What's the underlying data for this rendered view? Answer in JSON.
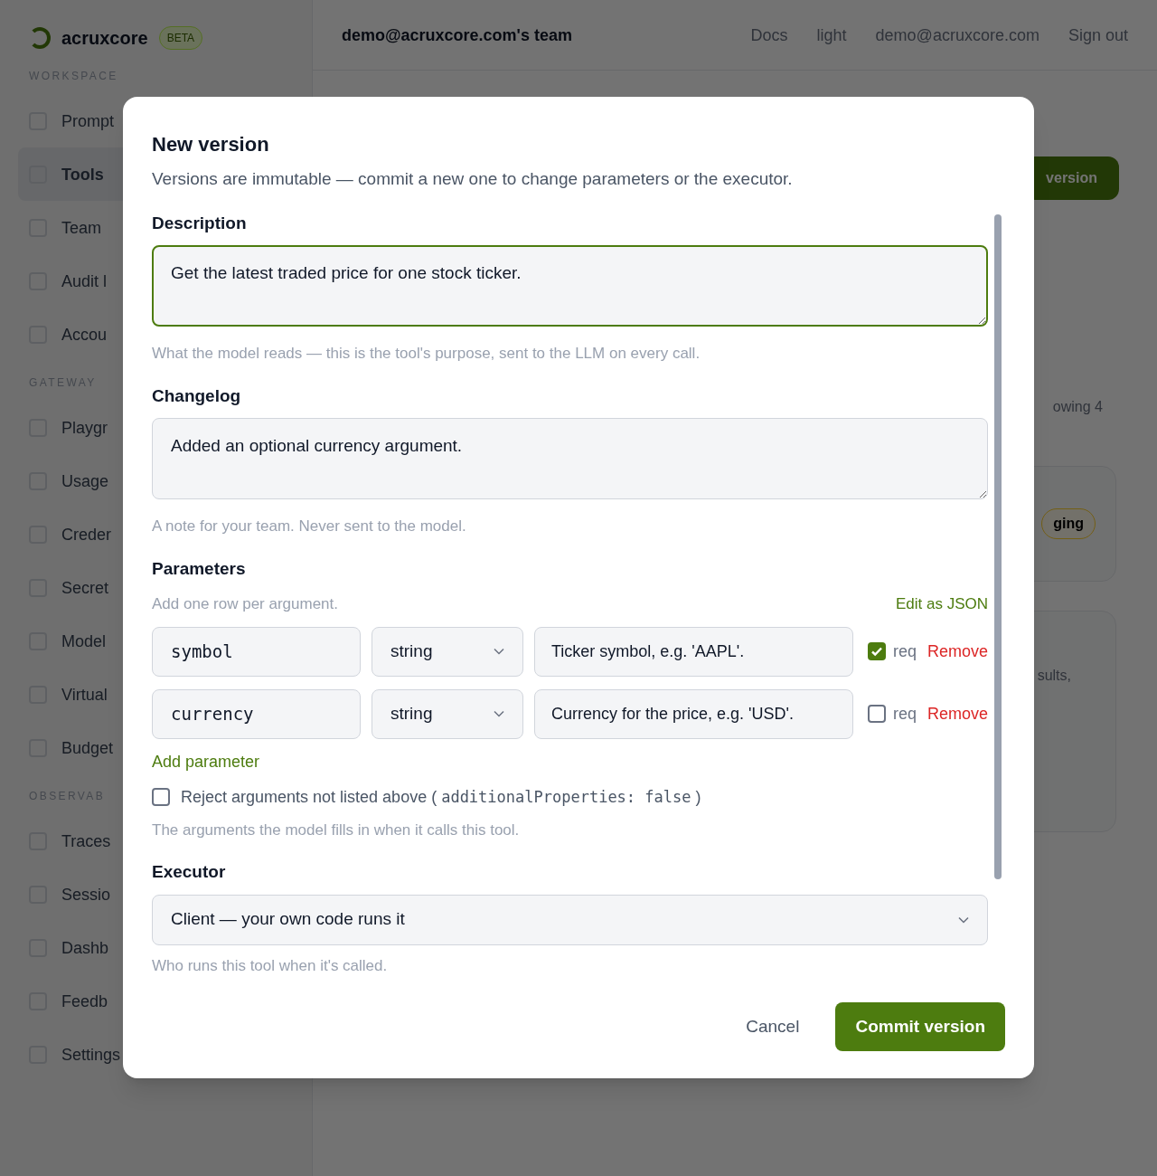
{
  "app": {
    "logo": "acruxcore",
    "badge": "BETA",
    "team": "demo@acruxcore.com's team",
    "docs": "Docs",
    "theme": "light",
    "email": "demo@acruxcore.com",
    "sign_out": "Sign out"
  },
  "sidebar": {
    "sections": [
      {
        "title": "WORKSPACE",
        "items": [
          {
            "label": "Prompt",
            "selected": false
          },
          {
            "label": "Tools",
            "selected": true
          },
          {
            "label": "Team",
            "selected": false
          },
          {
            "label": "Audit l",
            "selected": false
          },
          {
            "label": "Accou",
            "selected": false
          }
        ]
      },
      {
        "title": "GATEWAY",
        "items": [
          {
            "label": "Playgr",
            "selected": false
          },
          {
            "label": "Usage",
            "selected": false
          },
          {
            "label": "Creder",
            "selected": false
          },
          {
            "label": "Secret",
            "selected": false
          },
          {
            "label": "Model",
            "selected": false
          },
          {
            "label": "Virtual",
            "selected": false
          },
          {
            "label": "Budget",
            "selected": false
          }
        ]
      },
      {
        "title": "OBSERVAB",
        "items": [
          {
            "label": "Traces",
            "selected": false
          },
          {
            "label": "Sessio",
            "selected": false
          },
          {
            "label": "Dashb",
            "selected": false
          },
          {
            "label": "Feedb",
            "selected": false
          },
          {
            "label": "Settings",
            "selected": false
          }
        ]
      }
    ]
  },
  "background": {
    "button": "version",
    "count": "owing 4",
    "tag": "ging",
    "note": "sults,"
  },
  "dialog": {
    "title": "New version",
    "subtitle": "Versions are immutable — commit a new one to change parameters or the executor.",
    "description": {
      "label": "Description",
      "value": "Get the latest traded price for one stock ticker.",
      "focused": true,
      "help": "What the model reads — this is the tool's purpose, sent to the LLM on every call."
    },
    "changelog": {
      "label": "Changelog",
      "value": "Added an optional currency argument.",
      "focused": false,
      "help": "A note for your team. Never sent to the model."
    },
    "parameters": {
      "label": "Parameters",
      "hint": "Add one row per argument.",
      "edit_json": "Edit as JSON",
      "rows": [
        {
          "name": "symbol",
          "type": "string",
          "description": "Ticker symbol, e.g. 'AAPL'.",
          "required": true,
          "req_label": "req",
          "remove": "Remove"
        },
        {
          "name": "currency",
          "type": "string",
          "description": "Currency for the price, e.g. 'USD'.",
          "required": false,
          "req_label": "req",
          "remove": "Remove"
        }
      ],
      "add": "Add parameter",
      "reject": {
        "label": "Reject arguments not listed above (",
        "code": "additionalProperties: false",
        "close": ")",
        "checked": false
      },
      "help": "The arguments the model fills in when it calls this tool."
    },
    "executor": {
      "label": "Executor",
      "value": "Client — your own code runs it",
      "help": "Who runs this tool when it's called."
    },
    "cancel": "Cancel",
    "commit": "Commit version"
  }
}
